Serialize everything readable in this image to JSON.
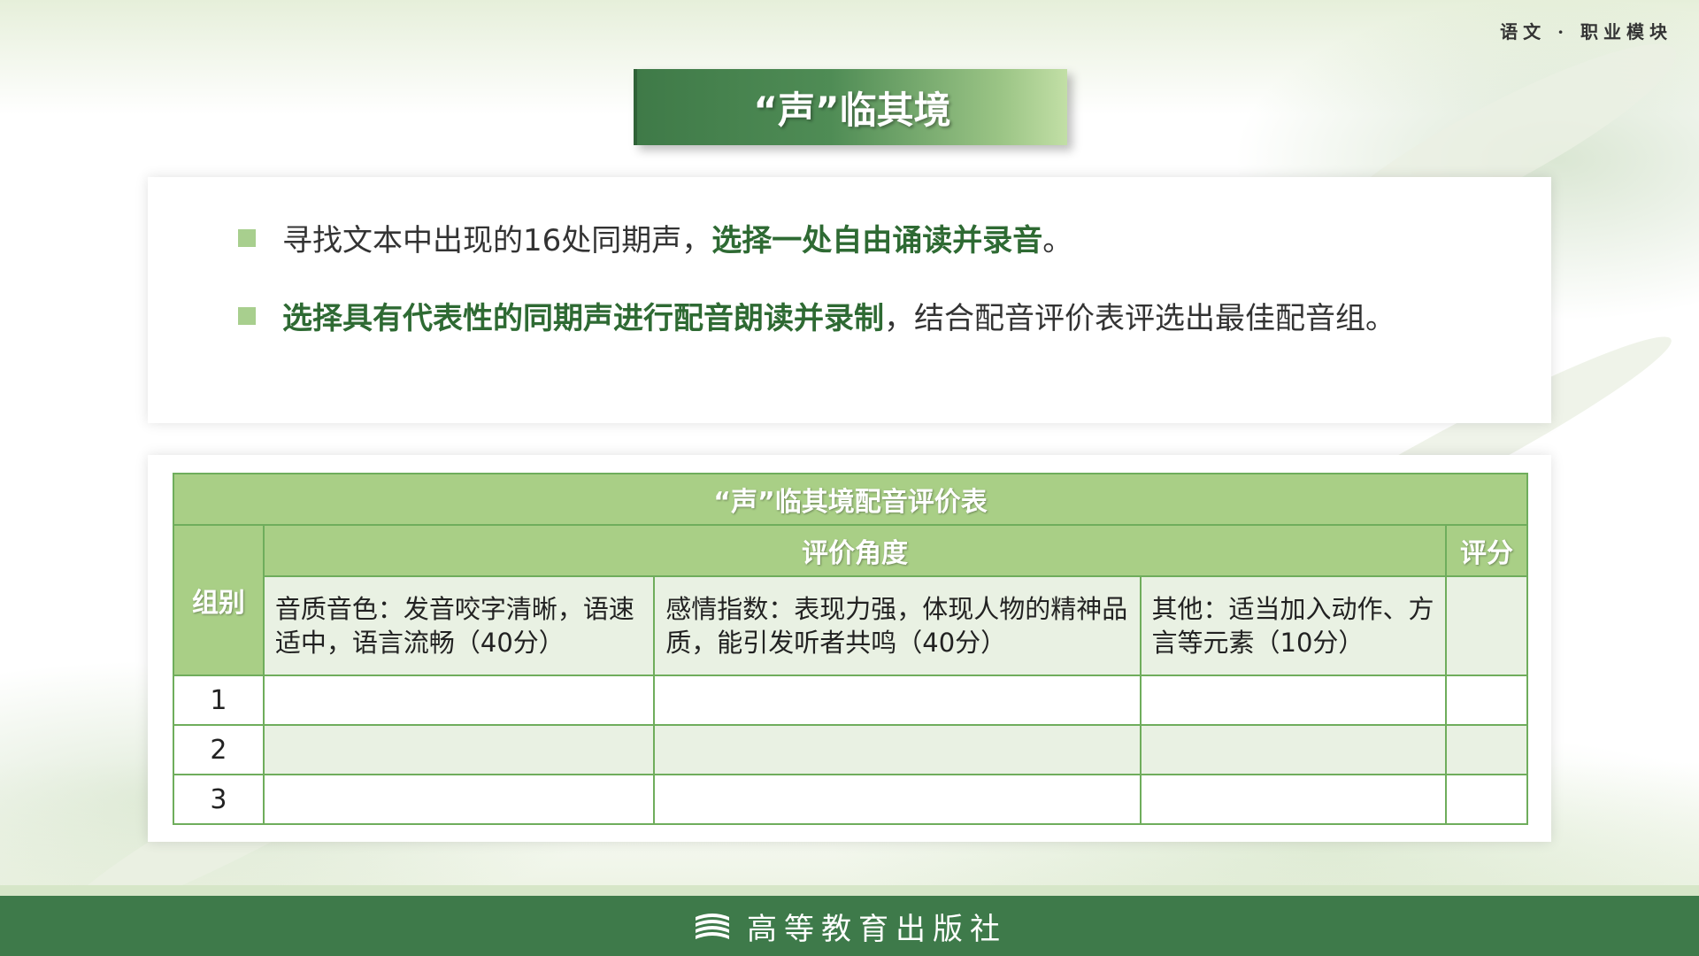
{
  "header": {
    "module_tag": "语文 · 职业模块",
    "title": "“声”临其境"
  },
  "bullets": [
    {
      "normal_before": "寻找文本中出现的16处同期声，",
      "highlight": "选择一处自由诵读并录音",
      "normal_after": "。"
    },
    {
      "normal_before": "",
      "highlight": "选择具有代表性的同期声进行配音朗读并录制",
      "normal_after": "，结合配音评价表评选出最佳配音组。"
    }
  ],
  "table": {
    "title": "“声”临其境配音评价表",
    "group_header": "组别",
    "angle_header": "评价角度",
    "score_header": "评分",
    "criteria": [
      "音质音色：发音咬字清晰，语速适中，语言流畅（40分）",
      "感情指数：表现力强，体现人物的精神品质，能引发听者共鸣（40分）",
      "其他：适当加入动作、方言等元素（10分）"
    ],
    "rows": [
      {
        "group": "1"
      },
      {
        "group": "2"
      },
      {
        "group": "3"
      }
    ]
  },
  "footer": {
    "publisher": "高等教育出版社"
  },
  "colors": {
    "brand_green": "#3e7a4a",
    "table_header": "#a9cf86",
    "highlight_text": "#2e6a33"
  }
}
